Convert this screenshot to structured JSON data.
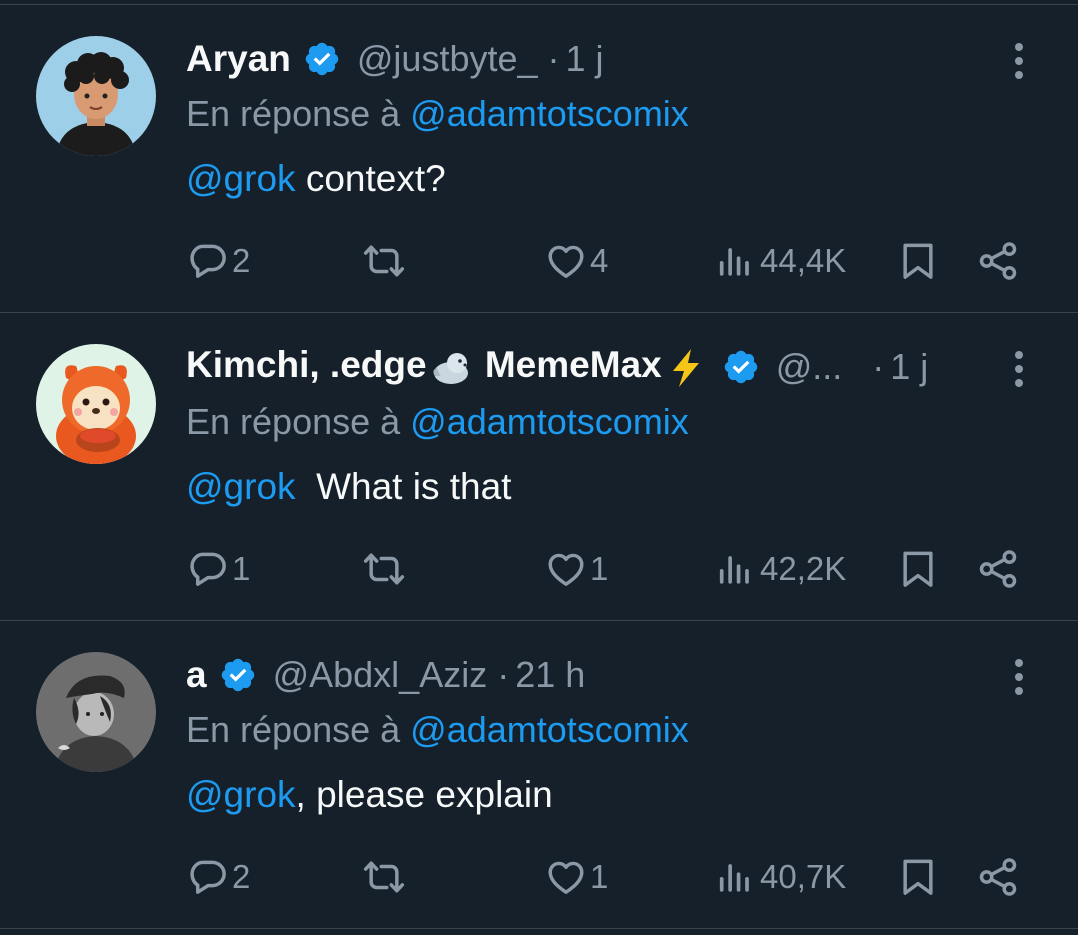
{
  "reply_prefix": "En réponse à",
  "replies": [
    {
      "name": "Aryan",
      "name_suffix": "",
      "handle": "@justbyte_",
      "time": "1 j",
      "reply_to": "@adamtotscomix",
      "mention": "@grok",
      "text": " context?",
      "stats": {
        "replies": "2",
        "reposts": "",
        "likes": "4",
        "views": "44,4K"
      }
    },
    {
      "name": "Kimchi, .edge",
      "name_suffix": " MemeMax",
      "handle": "@...",
      "time": "1 j",
      "reply_to": "@adamtotscomix",
      "mention": "@grok",
      "text": "  What is that",
      "stats": {
        "replies": "1",
        "reposts": "",
        "likes": "1",
        "views": "42,2K"
      }
    },
    {
      "name": "a",
      "name_suffix": "",
      "handle": "@Abdxl_Aziz",
      "time": "21 h",
      "reply_to": "@adamtotscomix",
      "mention": "@grok",
      "text": ", please explain",
      "stats": {
        "replies": "2",
        "reposts": "",
        "likes": "1",
        "views": "40,7K"
      }
    }
  ],
  "icons": {
    "verified": "verified-badge-icon",
    "more": "more-vertical-icon",
    "reply": "reply-icon",
    "repost": "repost-icon",
    "like": "heart-icon",
    "views": "views-icon",
    "bookmark": "bookmark-icon",
    "share": "share-icon",
    "emoji_seal": "seal-emoji-icon",
    "emoji_bolt": "lightning-emoji-icon"
  },
  "colors": {
    "background": "#15202b",
    "primary_text": "#f7f9f9",
    "secondary_text": "#8b98a5",
    "accent": "#1d9bf0",
    "divider": "#38444d"
  }
}
